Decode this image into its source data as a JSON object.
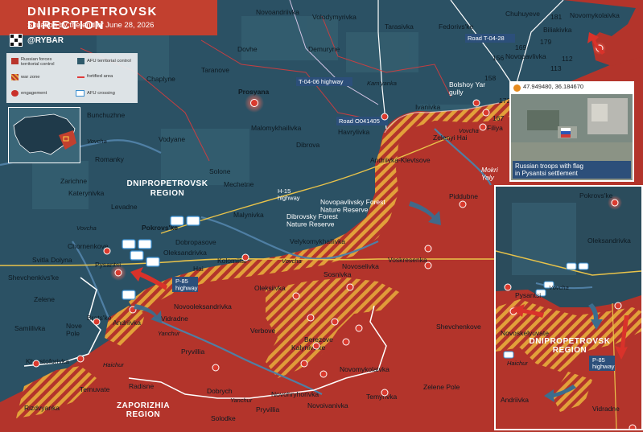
{
  "header": {
    "title": "DNIPROPETROVSK DIRECTION",
    "subtitle": "Situation by the end of June 28, 2026",
    "brand": "@RYBAR"
  },
  "legend": {
    "items": [
      {
        "label": "Russian forces territorial control",
        "color": "#b9352c"
      },
      {
        "label": "AFU territorial control",
        "color": "#2f5a6b"
      },
      {
        "label": "war zone",
        "color": "#e7a23b"
      },
      {
        "label": "fortified area",
        "color": "#e03b3b"
      },
      {
        "label": "engagement",
        "color": "#c9302a"
      },
      {
        "label": "AFU crossing",
        "color": "#3b8fd0"
      }
    ]
  },
  "regions": {
    "dnipro": "DNIPROPETROVSK\nREGION",
    "dnipro_l1": "DNIPROPETROVSK",
    "dnipro_l2": "REGION",
    "zap_l1": "ZAPORIZHIA",
    "zap_l2": "REGION"
  },
  "towns": {
    "chuhuyeve": "Chuhuyeve",
    "novomykolaivka": "Novomykolaivka",
    "biliakivka": "Biliakivka",
    "novoandriivka": "Novoandriivka",
    "volodymyrivka": "Volodymyrivka",
    "tarasivka": "Tarasivka",
    "fedorivske": "Fedorivs'ke",
    "dovhe": "Dovhe",
    "demuryne": "Demuryne",
    "taranove": "Taranove",
    "novopavlivka": "Novopavlivka",
    "chaplyne": "Chaplyne",
    "prosyana": "Prosyana",
    "kamyanka": "Kam'yanka",
    "bolshoy_yar": "Bolshoy Yar\ngully",
    "ivanivka": "Ivanivka",
    "filiya": "Filiya",
    "bunchuzhne": "Bunchuzhne",
    "malomykhailivka": "Malomykhailivka",
    "havrylivka": "Havrylivka",
    "zelenyi_hai": "Zelenyi Hai",
    "vovcha": "Vovcha",
    "vodyane": "Vodyane",
    "romanky": "Romanky",
    "dibrova": "Dibrova",
    "andriivka_klevtsove": "Andriivka-Klevtsove",
    "zarichne": "Zarichne",
    "solone": "Solone",
    "mechetne": "Mechetne",
    "katerynivka": "Katerynivka",
    "mokri_yaly": "Mokri\nYaly",
    "piddubne": "Piddubne",
    "levadne": "Levadne",
    "malynivka": "Malynivka",
    "novopavlivsky_forest": "Novopavlivsky Forest\nNature Reserve",
    "dibrovsky_forest": "Dibrovsky Forest\nNature Reserve",
    "pokrovske": "Pokrovs'ke",
    "dobropasove": "Dobropasove",
    "velykomykhailivka": "Velykomykhailivka",
    "chornenkove": "Chornenkove",
    "oleksandrivka": "Oleksandrivka",
    "svitla_dolyna": "Svitla Dolyna",
    "kolomiitsi": "Kolomiitsi",
    "novoselivka": "Novoselivka",
    "voskresenka": "Voskresenka",
    "pysantsi": "Pysantsi",
    "shevchenkivske": "Shevchenkivs'ke",
    "sosnivka": "Sosnivka",
    "hai": "Hai",
    "zelene": "Zelene",
    "oleksiivka": "Oleksiivka",
    "novooleksandrivka": "Novooleksandrivka",
    "samiilivka": "Samiilivka",
    "bratske": "Brats'ke",
    "andriivka": "Andriivka",
    "vidradne": "Vidradne",
    "nove_pole": "Nove\nPole",
    "shevchenkove": "Shevchenkove",
    "verbove": "Verbove",
    "berezove": "Berezove",
    "yanchur": "Yanchur",
    "kalynivske": "Kalynivs'ke",
    "khrystoforivka": "Khrystoforivka",
    "pryvillia": "Pryvillia",
    "novomykolaivka_s": "Novomykolaivka",
    "haichur": "Haichur",
    "ternuvate": "Ternuvate",
    "radisne": "Radisne",
    "zelene_pole": "Zelene Pole",
    "dobrych": "Dobrych",
    "novohryhorivka": "Novohryhorivka",
    "temyrivka": "Temyrivka",
    "rizdvyanka": "Rizdvyanka",
    "pryvillia2": "Pryvillia",
    "novoivanivka": "Novoivanivka",
    "solodke": "Solodke"
  },
  "roads": {
    "t0428": "Road  T-04-28",
    "t0406": "T-04-06 highway",
    "o041405": "Road  O041405",
    "h15": "H-15\nhighway",
    "p85": "P-85\nhighway"
  },
  "road_numbers": [
    "181",
    "179",
    "169",
    "156",
    "112",
    "113",
    "158",
    "172",
    "167"
  ],
  "photo": {
    "coords": "47.949480, 36.184670",
    "caption": "Russian troops with flag\nin Pysantsi settlement"
  },
  "zoom": {
    "pokrovske": "Pokrovs'ke",
    "oleksandrivka": "Oleksandrivka",
    "pysantsi": "Pysantsi",
    "novoskelyuvate": "Novoskelyuvate",
    "region_l1": "DNIPROPETROVSK",
    "region_l2": "REGION",
    "vovcha": "Vovcha",
    "haichur": "Haichur",
    "p85": "P-85\nhighway",
    "andriivka": "Andriivka",
    "vidradne": "Vidradne"
  }
}
